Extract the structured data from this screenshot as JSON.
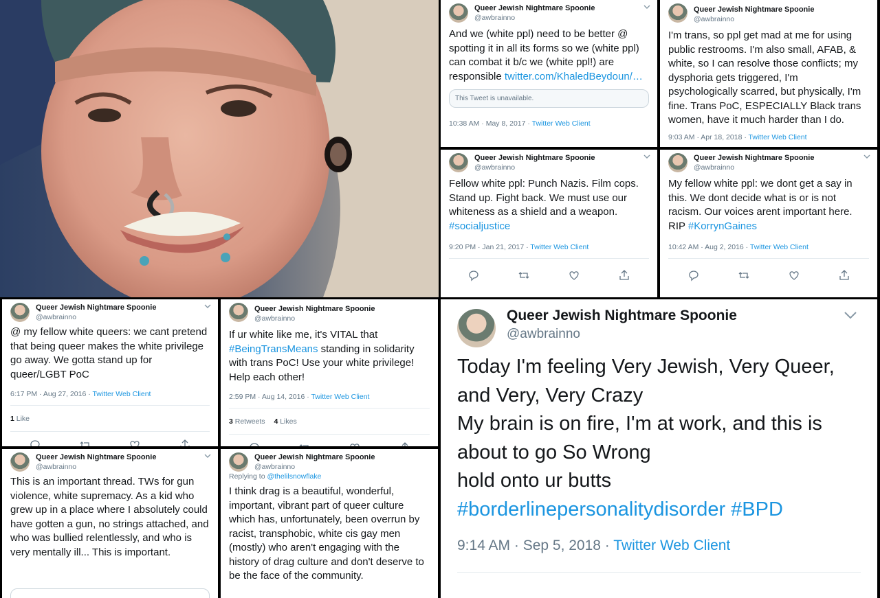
{
  "author": {
    "name": "Queer Jewish Nightmare Spoonie",
    "handle": "@awbrainno"
  },
  "tweets": {
    "t1": {
      "text": "And we (white ppl) need to be better @ spotting it in all its forms so we (white ppl) can combat it b/c we (white ppl!) are responsible ",
      "link": "twitter.com/KhaledBeydoun/…",
      "quote_unavailable": "This Tweet is unavailable.",
      "time": "10:38 AM · May 8, 2017 · ",
      "client": "Twitter Web Client"
    },
    "t2": {
      "text": "I'm trans, so ppl get mad at me for using public restrooms. I'm also small, AFAB, & white, so I can resolve those conflicts; my dysphoria gets triggered, I'm psychologically scarred, but physically, I'm fine. Trans PoC, ESPECIALLY Black trans women, have it much harder than I do.",
      "time": "9:03 AM · Apr 18, 2018 · ",
      "client": "Twitter Web Client"
    },
    "t3": {
      "text": "Fellow white ppl: Punch Nazis. Film cops. Stand up. Fight back. We must use our whiteness as a shield and a weapon. ",
      "hashtag": "#socialjustice",
      "time": "9:20 PM · Jan 21, 2017 · ",
      "client": "Twitter Web Client"
    },
    "t4": {
      "text": "My fellow white ppl: we dont get a say in this. We dont decide what is or is not racism. Our voices arent important here. RIP ",
      "hashtag": "#KorrynGaines",
      "time": "10:42 AM · Aug 2, 2016 · ",
      "client": "Twitter Web Client"
    },
    "t5": {
      "text": "@ my fellow white queers: we cant pretend that being queer makes the white privilege go away. We gotta stand up for queer/LGBT PoC",
      "time": "6:17 PM · Aug 27, 2016 · ",
      "client": "Twitter Web Client",
      "likes_count": "1",
      "likes_label": " Like"
    },
    "t6": {
      "text_before": "If ur white like me, it's VITAL that ",
      "hashtag": "#BeingTransMeans",
      "text_after": " standing in solidarity with trans PoC! Use your white privilege! Help each other!",
      "time": "2:59 PM · Aug 14, 2016 · ",
      "client": "Twitter Web Client",
      "retweets_count": "3",
      "retweets_label": " Retweets",
      "likes_count": "4",
      "likes_label": " Likes"
    },
    "t7": {
      "text": "This is an important thread. TWs for gun violence, white supremacy. As a kid who grew up in a place where I absolutely could have gotten a gun, no strings attached, and who was bullied relentlessly, and who is very mentally ill... This is important."
    },
    "t8": {
      "replying_prefix": "Replying to ",
      "replying_to": "@thelilsnowflake",
      "text": "I think drag is a beautiful, wonderful, important, vibrant part of queer culture which has, unfortunately, been overrun by racist, transphobic, white cis gay men (mostly) who aren't engaging with the history of drag culture and don't deserve to be the face of the community."
    },
    "big": {
      "line1": "Today I'm feeling Very Jewish, Very Queer, and Very, Very Crazy",
      "line2": "My brain is on fire, I'm at work, and this is about to go So Wrong",
      "line3": "hold onto ur butts",
      "hashtags": "#borderlinepersonalitydisorder #BPD",
      "time": "9:14 AM · Sep 5, 2018 · ",
      "client": "Twitter Web Client"
    }
  },
  "icons": [
    "chevron-down-icon",
    "reply-icon",
    "retweet-icon",
    "like-icon",
    "share-icon"
  ],
  "colors": {
    "link": "#1b95e0",
    "text": "#14171a",
    "muted": "#657786",
    "border": "#e6ecf0"
  }
}
